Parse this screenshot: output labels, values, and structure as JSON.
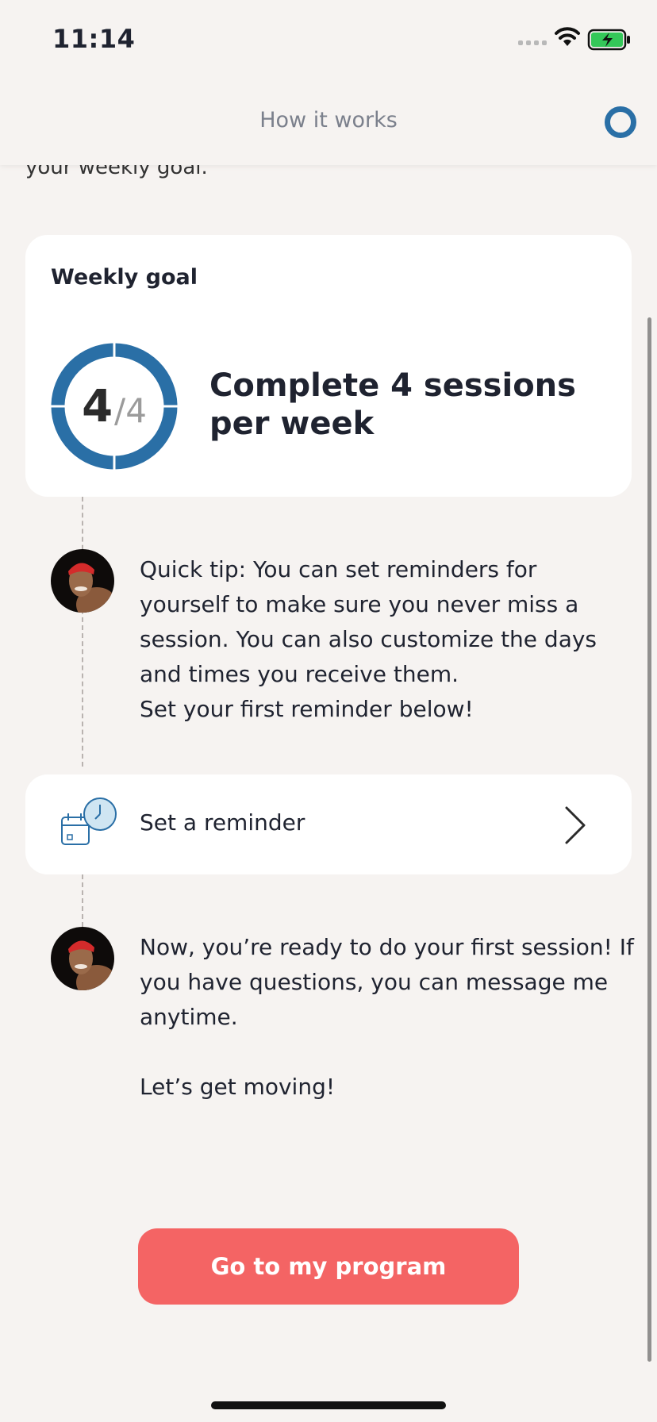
{
  "status_bar": {
    "time": "11:14"
  },
  "header": {
    "title": "How it works"
  },
  "intro": {
    "tail_text": "your weekly goal."
  },
  "goal": {
    "label": "Weekly goal",
    "completed": "4",
    "total": "/4",
    "description": "Complete 4 sessions per week"
  },
  "messages": [
    {
      "text": "Quick tip: You can set reminders for\nyourself to make sure you never miss a\nsession. You can also customize the days\nand times you receive them.\nSet your first reminder below!"
    },
    {
      "text": "Now, you’re ready to do your first session! If\nyou have questions, you can message me\nanytime.\n\nLet’s get moving!"
    }
  ],
  "reminder": {
    "label": "Set a reminder",
    "icon": "calendar-clock-icon"
  },
  "cta": {
    "label": "Go to my program"
  },
  "colors": {
    "accent": "#2a6fa6",
    "cta": "#f46464",
    "background": "#f6f3f1"
  }
}
